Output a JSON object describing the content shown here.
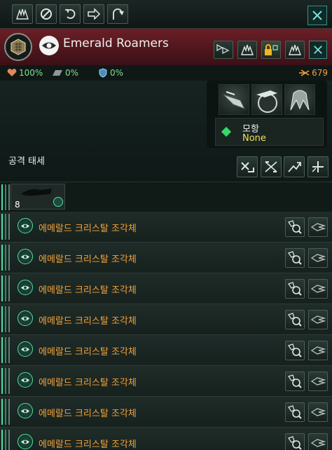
{
  "colors": {
    "accent": "#4fe0a6",
    "header_red": "#6b1f26",
    "name_orange": "#f4a23a",
    "stat_green": "#7de38f",
    "value_yellow": "#f1e05a"
  },
  "toolbar": {
    "icons": [
      "fleet-formation-icon",
      "cancel-icon",
      "undo-icon",
      "forward-arrow-icon",
      "return-arrow-icon"
    ],
    "close_icon": "close-icon"
  },
  "fleet": {
    "name": "Emerald Roamers",
    "emblem_icon": "hexagon-shield-icon",
    "species_icon": "eye-icon",
    "header_buttons": [
      "merge-fleet-icon",
      "fleet-ships-icon",
      "lock-icon",
      "fleet-detach-icon",
      "close-icon"
    ]
  },
  "stats": {
    "health": "100%",
    "armor": "0%",
    "shield": "0%",
    "power": "679"
  },
  "stance": {
    "label": "공격 태세",
    "buttons": [
      "aggressive-stance-icon",
      "evasive-stance-icon",
      "passive-stance-icon",
      "reinforce-stance-icon"
    ]
  },
  "modifier": {
    "title": "모항",
    "value": "None"
  },
  "ship_portraits": [
    "crystal-ship-icon",
    "planet-ship-icon",
    "station-ship-icon"
  ],
  "summary": {
    "count": "8"
  },
  "ships": [
    {
      "name": "에메랄드 크리스탈 조각체"
    },
    {
      "name": "에메랄드 크리스탈 조각체"
    },
    {
      "name": "에메랄드 크리스탈 조각체"
    },
    {
      "name": "에메랄드 크리스탈 조각체"
    },
    {
      "name": "에메랄드 크리스탈 조각체"
    },
    {
      "name": "에메랄드 크리스탈 조각체"
    },
    {
      "name": "에메랄드 크리스탈 조각체"
    },
    {
      "name": "에메랄드 크리스탈 조각체"
    }
  ]
}
